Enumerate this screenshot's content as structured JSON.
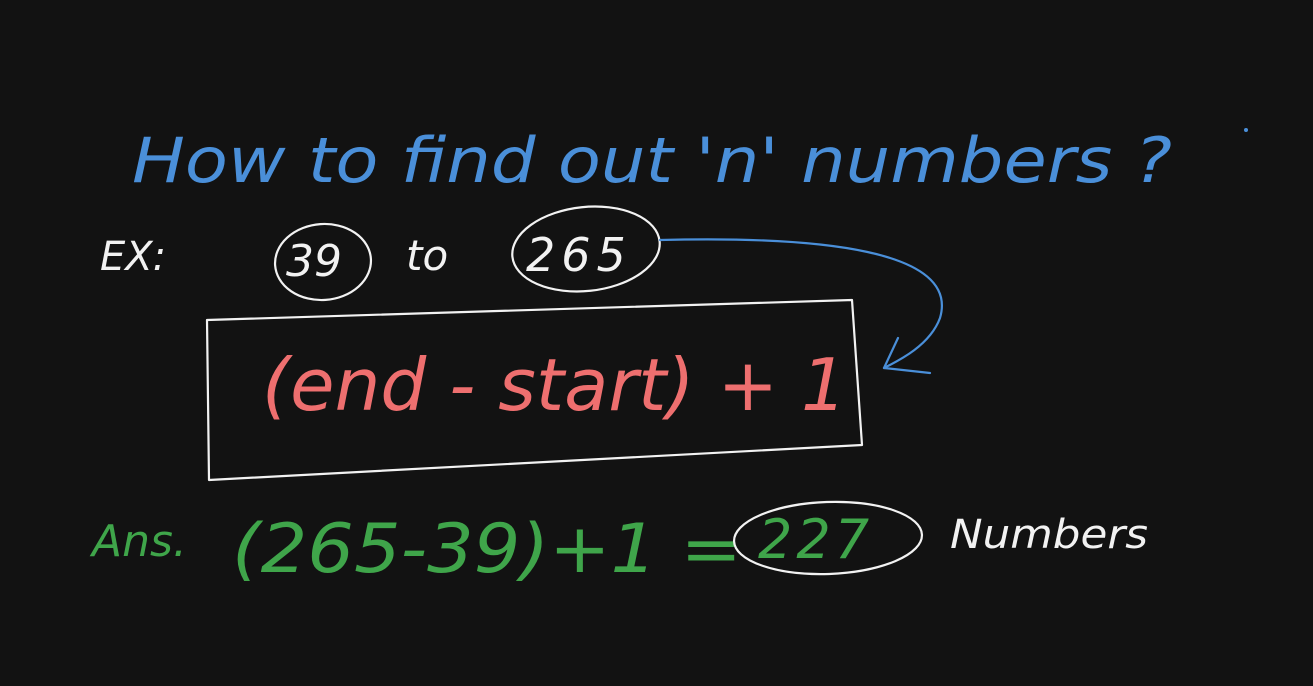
{
  "question": "How to find out 'n' numbers ?",
  "example": {
    "prefix": "EX:",
    "start": "39",
    "connector": "to",
    "end": "265"
  },
  "formula": "(end - start) + 1",
  "answer": {
    "prefix": "Ans.",
    "expression": "(265-39)+1 =",
    "result": "227",
    "suffix": "Numbers"
  },
  "colors": {
    "background": "#121212",
    "question": "#4a8fd9",
    "example": "#f2f2f2",
    "formula": "#ee6f6f",
    "answer": "#3fa54a",
    "arrow": "#4a8fd9"
  }
}
